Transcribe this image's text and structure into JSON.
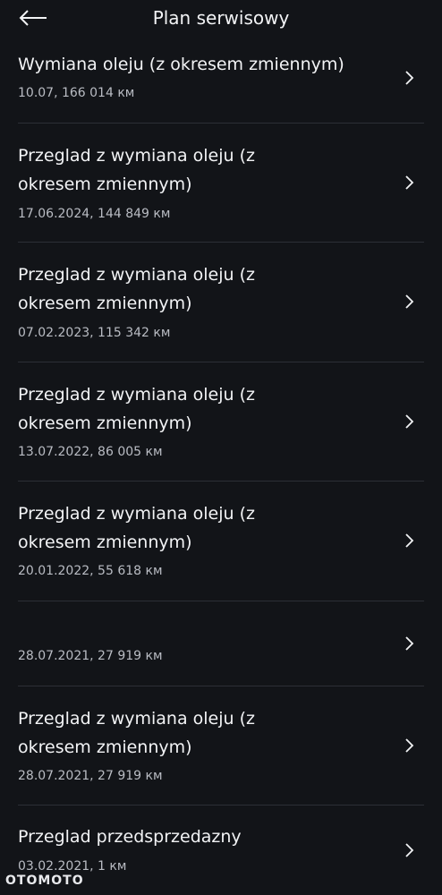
{
  "header": {
    "title": "Plan serwisowy",
    "back_icon": "arrow-left-icon"
  },
  "items": [
    {
      "title_lines": [
        "Wymiana oleju (z okresem zmiennym)"
      ],
      "subtitle": "10.07, 166 014 км"
    },
    {
      "title_lines": [
        "Przeglad z wymiana oleju (z",
        "okresem zmiennym)"
      ],
      "subtitle": "17.06.2024, 144 849 км"
    },
    {
      "title_lines": [
        "Przeglad z wymiana oleju (z",
        "okresem zmiennym)"
      ],
      "subtitle": "07.02.2023, 115 342 км"
    },
    {
      "title_lines": [
        "Przeglad z wymiana oleju (z",
        "okresem zmiennym)"
      ],
      "subtitle": "13.07.2022, 86 005 км"
    },
    {
      "title_lines": [
        "Przeglad z wymiana oleju (z",
        "okresem zmiennym)"
      ],
      "subtitle": "20.01.2022, 55 618 км"
    },
    {
      "title_lines": [],
      "subtitle": "28.07.2021, 27 919 км"
    },
    {
      "title_lines": [
        "Przeglad z wymiana oleju (z",
        "okresem zmiennym)"
      ],
      "subtitle": "28.07.2021, 27 919 км"
    },
    {
      "title_lines": [
        "Przeglad przedsprzedazny"
      ],
      "subtitle": "03.02.2021, 1 км"
    }
  ],
  "watermark": "OTOMOTO",
  "colors": {
    "background": "#121418",
    "text": "#f2f3f5",
    "subtext": "#b9bcc3",
    "divider": "#2c2f36"
  }
}
